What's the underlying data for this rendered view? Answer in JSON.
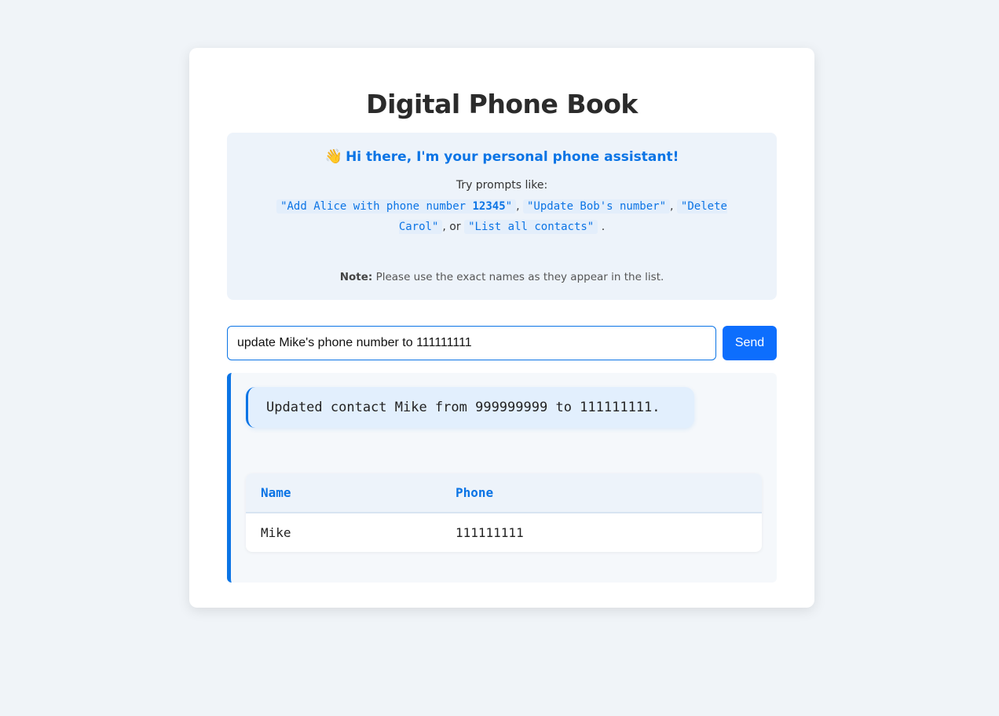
{
  "app": {
    "title": "Digital Phone Book"
  },
  "intro": {
    "icon": "waving-hand-icon",
    "heading": "Hi there, I'm your personal phone assistant!",
    "try_label": "Try prompts like:",
    "examples": {
      "ex1_prefix": "\"Add Alice with phone number ",
      "ex1_number": "12345",
      "ex1_suffix": "\"",
      "sep1": ",",
      "ex2": "\"Update Bob's number\"",
      "sep2": ",",
      "ex3": "\"Delete Carol\"",
      "sep3": ", or",
      "ex4": "\"List all contacts\"",
      "end": "."
    },
    "note_label": "Note:",
    "note_text": "Please use the exact names as they appear in the list."
  },
  "prompt": {
    "value": "update Mike's phone number to 111111111",
    "send_label": "Send"
  },
  "output": {
    "message": "Updated contact Mike from 999999999 to 111111111.",
    "table": {
      "headers": [
        "Name",
        "Phone"
      ],
      "rows": [
        [
          "Mike",
          "111111111"
        ]
      ]
    }
  },
  "colors": {
    "accent": "#0b74e5",
    "button": "#0d6efd",
    "background": "#f0f4f8"
  }
}
